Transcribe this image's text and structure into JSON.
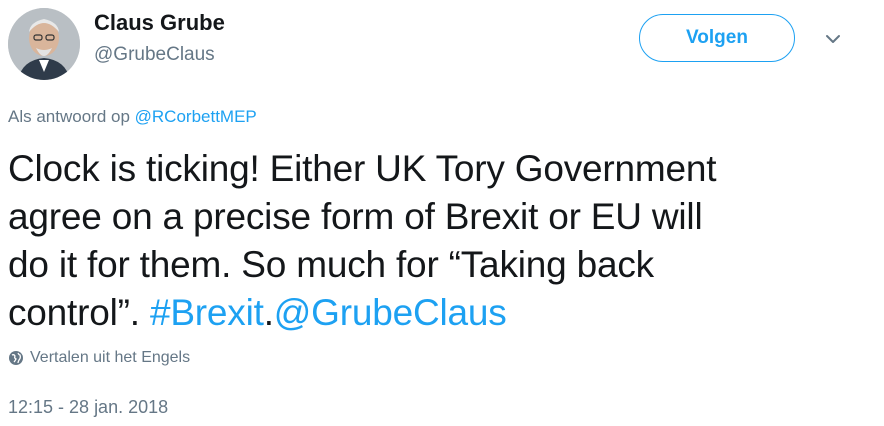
{
  "author": {
    "name": "Claus Grube",
    "handle": "@GrubeClaus"
  },
  "actions": {
    "follow_label": "Volgen"
  },
  "reply": {
    "prefix": "Als antwoord op",
    "mention": "@RCorbettMEP"
  },
  "tweet": {
    "line1": "Clock is ticking! Either UK Tory Government",
    "line2": "agree on a precise form of Brexit or EU will",
    "line3": "do it for them. So much for “Taking back",
    "line4_text": "control”. ",
    "hashtag": "#Brexit",
    "dot": ".",
    "mention": "@GrubeClaus"
  },
  "translate": {
    "label": "Vertalen uit het Engels"
  },
  "meta": {
    "timestamp": "12:15 - 28 jan. 2018"
  },
  "colors": {
    "accent": "#1da1f2",
    "text": "#14171a",
    "muted": "#657786"
  }
}
